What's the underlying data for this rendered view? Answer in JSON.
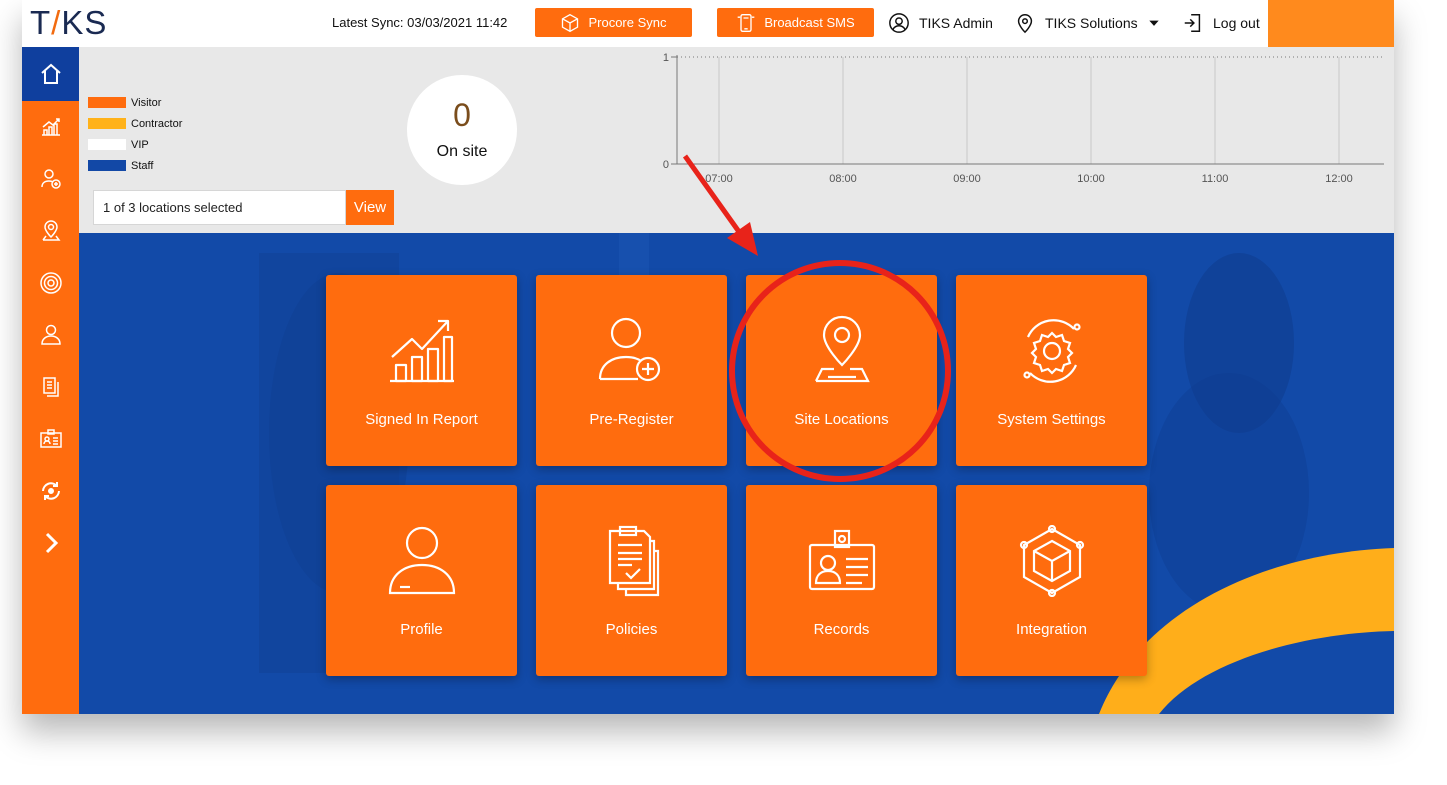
{
  "header": {
    "logo_left": "T",
    "logo_slash": "/",
    "logo_right": "KS",
    "latest_sync": "Latest Sync: 03/03/2021 11:42",
    "procore_sync_label": "Procore Sync",
    "broadcast_sms_label": "Broadcast SMS",
    "user_label": "TIKS Admin",
    "company_label": "TIKS Solutions",
    "logout_label": "Log out"
  },
  "legend": [
    {
      "label": "Visitor",
      "color": "#ff6c0e"
    },
    {
      "label": "Contractor",
      "color": "#ffb21a"
    },
    {
      "label": "VIP",
      "color": "#ffffff"
    },
    {
      "label": "Staff",
      "color": "#1248a6"
    }
  ],
  "onsite": {
    "count": "0",
    "label": "On site"
  },
  "location_select": {
    "value": "1 of 3 locations selected",
    "view_label": "View"
  },
  "chart_data": {
    "type": "line",
    "x": [
      "07:00",
      "08:00",
      "09:00",
      "10:00",
      "11:00",
      "12:00"
    ],
    "y_ticks": [
      "1",
      "0"
    ],
    "ylim": [
      0,
      1
    ],
    "series": [],
    "grid": true
  },
  "tiles": [
    {
      "label": "Signed In Report",
      "icon": "chart-growth-icon"
    },
    {
      "label": "Pre-Register",
      "icon": "user-add-icon"
    },
    {
      "label": "Site Locations",
      "icon": "location-pin-icon"
    },
    {
      "label": "System Settings",
      "icon": "gear-icon"
    },
    {
      "label": "Profile",
      "icon": "person-icon"
    },
    {
      "label": "Policies",
      "icon": "document-check-icon"
    },
    {
      "label": "Records",
      "icon": "id-card-icon"
    },
    {
      "label": "Integration",
      "icon": "cube-network-icon"
    }
  ],
  "sidebar": [
    "home-icon",
    "chart-growth-icon",
    "user-add-icon",
    "location-pin-icon",
    "gear-icon",
    "person-icon",
    "document-icon",
    "id-card-icon",
    "sync-icon",
    "chevron-right-icon"
  ],
  "colors": {
    "orange": "#ff6c0e",
    "blue": "#124aa8",
    "sidebar_active": "#0f3f9e",
    "annotation_red": "#e8231a"
  }
}
